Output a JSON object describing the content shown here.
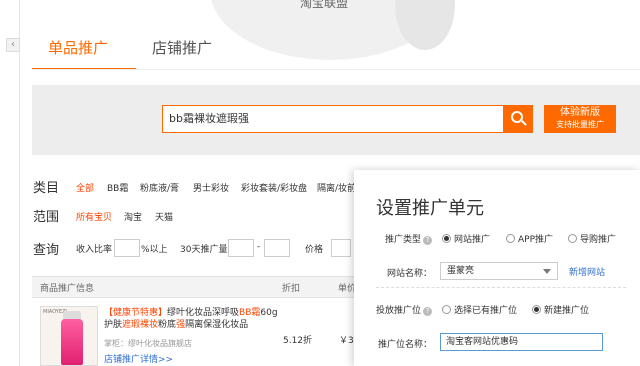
{
  "header": {
    "brand": "淘宝联盟"
  },
  "tabs": [
    {
      "label": "单品推广",
      "active": true
    },
    {
      "label": "店铺推广",
      "active": false
    }
  ],
  "search": {
    "value": "bb霜裸妆遮瑕强"
  },
  "promo_button": {
    "line1": "体验新版",
    "line2": "支持批量推广"
  },
  "filters": {
    "category_label": "类目",
    "categories": [
      "全部",
      "BB霜",
      "粉底液/膏",
      "男士彩妆",
      "彩妆套装/彩妆盘",
      "隔离/妆前"
    ],
    "scope_label": "范围",
    "scopes": [
      "所有宝贝",
      "淘宝",
      "天猫"
    ],
    "query_label": "查询",
    "income_ratio": "收入比率",
    "above": "%以上",
    "sales_30": "30天推广量",
    "dash": "-",
    "price": "价格"
  },
  "table": {
    "headers": [
      "商品推广信息",
      "折扣",
      "单价"
    ],
    "rows": [
      {
        "tag": "【健康节特惠】",
        "title_a": "缪叶化妆品深呼吸",
        "title_hl1": "BB霜",
        "title_b": "60g 护肤",
        "title_hl2": "遮瑕",
        "title_hl3": "裸妆",
        "title_c": "粉底",
        "title_hl4": "强",
        "title_d": "隔离保湿化妆品",
        "img_brand": "MIAOYEZI",
        "shop": "掌柜：缪叶化妆品旗舰店",
        "link": "店铺推广详情>>",
        "discount": "5.12折",
        "price": "￥3"
      }
    ]
  },
  "modal": {
    "title": "设置推广单元",
    "promo_type_label": "推广类型",
    "promo_types": [
      "网站推广",
      "APP推广",
      "导购推广"
    ],
    "promo_type_selected": 0,
    "site_name_label": "网站名称：",
    "site_name_value": "蛋蒙亮",
    "new_site_link": "新增网站",
    "slot_label": "投放推广位",
    "slot_options": [
      "选择已有推广位",
      "新建推广位"
    ],
    "slot_selected": 1,
    "slot_name_label": "推广位名称：",
    "slot_name_value": "淘宝客网站优惠码"
  }
}
